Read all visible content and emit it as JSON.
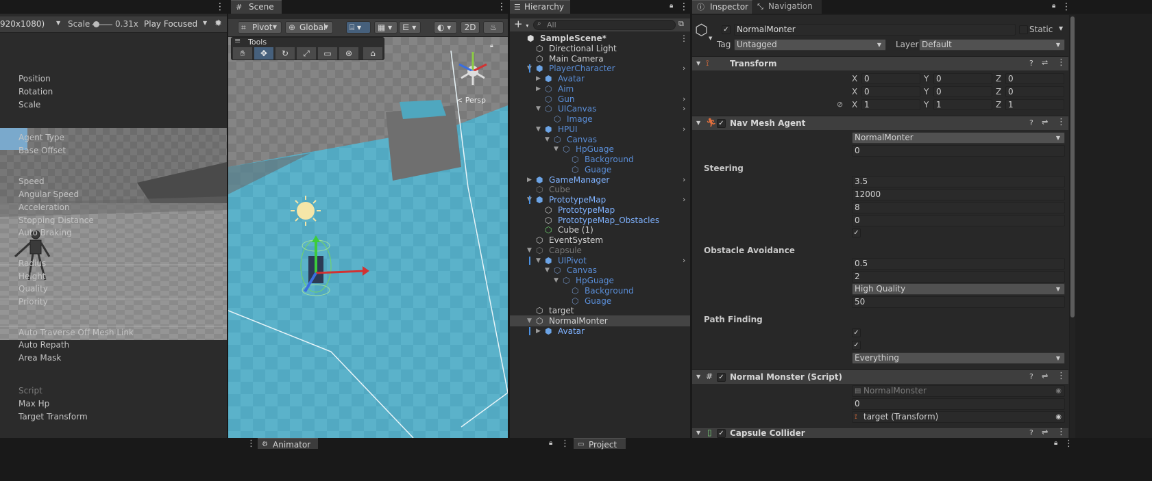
{
  "game": {
    "resolution": "920x1080)",
    "scale_label": "Scale",
    "scale_value": "0.31x",
    "play_mode": "Play Focused"
  },
  "scene": {
    "tab": "Scene",
    "pivot": "Pivot",
    "global": "Global",
    "mode_2d": "2D",
    "tools_label": "Tools",
    "persp": "< Persp"
  },
  "hierarchy": {
    "tab": "Hierarchy",
    "search_placeholder": "All",
    "items": [
      {
        "label": "SampleScene*",
        "depth": 0,
        "type": "scene",
        "style": "white"
      },
      {
        "label": "Directional Light",
        "depth": 1,
        "type": "object",
        "style": "white"
      },
      {
        "label": "Main Camera",
        "depth": 1,
        "type": "object",
        "style": "white"
      },
      {
        "label": "PlayerCharacter",
        "depth": 1,
        "type": "prefab",
        "style": "blue",
        "expand": "open"
      },
      {
        "label": "Avatar",
        "depth": 2,
        "type": "prefab",
        "style": "blue",
        "expand": "closed"
      },
      {
        "label": "Aim",
        "depth": 2,
        "type": "object",
        "style": "blue",
        "expand": "closed"
      },
      {
        "label": "Gun",
        "depth": 2,
        "type": "object",
        "style": "blue"
      },
      {
        "label": "UICanvas",
        "depth": 2,
        "type": "object",
        "style": "blue",
        "expand": "open"
      },
      {
        "label": "Image",
        "depth": 3,
        "type": "object",
        "style": "blue"
      },
      {
        "label": "HPUI",
        "depth": 2,
        "type": "prefab",
        "style": "blue",
        "expand": "open"
      },
      {
        "label": "Canvas",
        "depth": 3,
        "type": "object",
        "style": "blue",
        "expand": "open"
      },
      {
        "label": "HpGuage",
        "depth": 4,
        "type": "object",
        "style": "blue",
        "expand": "open"
      },
      {
        "label": "Background",
        "depth": 5,
        "type": "object",
        "style": "blue"
      },
      {
        "label": "Guage",
        "depth": 5,
        "type": "object",
        "style": "blue"
      },
      {
        "label": "GameManager",
        "depth": 1,
        "type": "prefab",
        "style": "bright",
        "expand": "closed"
      },
      {
        "label": "Cube",
        "depth": 1,
        "type": "object",
        "style": "dim"
      },
      {
        "label": "PrototypeMap",
        "depth": 1,
        "type": "prefab",
        "style": "bright",
        "expand": "open"
      },
      {
        "label": "PrototypeMap",
        "depth": 2,
        "type": "object",
        "style": "bright"
      },
      {
        "label": "PrototypeMap_Obstacles",
        "depth": 2,
        "type": "object",
        "style": "bright"
      },
      {
        "label": "Cube (1)",
        "depth": 2,
        "type": "object-green",
        "style": "white"
      },
      {
        "label": "EventSystem",
        "depth": 1,
        "type": "object",
        "style": "white"
      },
      {
        "label": "Capsule",
        "depth": 1,
        "type": "object",
        "style": "dim",
        "expand": "open"
      },
      {
        "label": "UIPivot",
        "depth": 2,
        "type": "prefab",
        "style": "blue",
        "expand": "open"
      },
      {
        "label": "Canvas",
        "depth": 3,
        "type": "object",
        "style": "blue",
        "expand": "open"
      },
      {
        "label": "HpGuage",
        "depth": 4,
        "type": "object",
        "style": "blue",
        "expand": "open"
      },
      {
        "label": "Background",
        "depth": 5,
        "type": "object",
        "style": "blue"
      },
      {
        "label": "Guage",
        "depth": 5,
        "type": "object",
        "style": "blue"
      },
      {
        "label": "target",
        "depth": 1,
        "type": "object",
        "style": "white"
      },
      {
        "label": "NormalMonter",
        "depth": 1,
        "type": "object",
        "style": "white",
        "expand": "open",
        "selected": true
      },
      {
        "label": "Avatar",
        "depth": 2,
        "type": "prefab",
        "style": "bright",
        "expand": "closed"
      }
    ]
  },
  "inspector": {
    "tab": "Inspector",
    "nav_tab": "Navigation",
    "object_name": "NormalMonter",
    "static_label": "Static",
    "tag_label": "Tag",
    "tag_value": "Untagged",
    "layer_label": "Layer",
    "layer_value": "Default",
    "transform": {
      "title": "Transform",
      "position_label": "Position",
      "px": "0",
      "py": "0",
      "pz": "0",
      "rotation_label": "Rotation",
      "rx": "0",
      "ry": "0",
      "rz": "0",
      "scale_label": "Scale",
      "sx": "1",
      "sy": "1",
      "sz": "1",
      "x": "X",
      "y": "Y",
      "z": "Z"
    },
    "navmesh": {
      "title": "Nav Mesh Agent",
      "agent_type_label": "Agent Type",
      "agent_type": "NormalMonter",
      "base_offset_label": "Base Offset",
      "base_offset": "0",
      "steering": "Steering",
      "speed_label": "Speed",
      "speed": "3.5",
      "angular_label": "Angular Speed",
      "angular": "12000",
      "accel_label": "Acceleration",
      "accel": "8",
      "stopping_label": "Stopping Distance",
      "stopping": "0",
      "auto_braking_label": "Auto Braking",
      "obstacle": "Obstacle Avoidance",
      "radius_label": "Radius",
      "radius": "0.5",
      "height_label": "Height",
      "height": "2",
      "quality_label": "Quality",
      "quality": "High Quality",
      "priority_label": "Priority",
      "priority": "50",
      "path": "Path Finding",
      "traverse_label": "Auto Traverse Off Mesh Link",
      "repath_label": "Auto Repath",
      "area_label": "Area Mask",
      "area": "Everything"
    },
    "script": {
      "title": "Normal Monster (Script)",
      "script_label": "Script",
      "script_value": "NormalMonster",
      "maxhp_label": "Max Hp",
      "maxhp": "0",
      "target_label": "Target Transform",
      "target": "target (Transform)"
    },
    "collider": {
      "title": "Capsule Collider"
    }
  },
  "bottom": {
    "animator": "Animator",
    "project": "Project"
  },
  "colors": {
    "selection": "#46607c",
    "prefab_blue": "#5a8ed8",
    "panel": "#282828"
  }
}
